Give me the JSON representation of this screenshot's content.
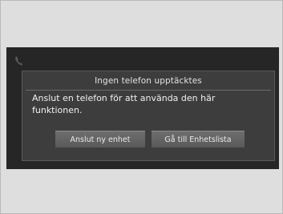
{
  "dialog": {
    "title": "Ingen telefon upptäcktes",
    "message": "Anslut en telefon för att använda den här funktionen.",
    "buttons": {
      "connect_label": "Anslut ny enhet",
      "device_list_label": "Gå till Enhetslista"
    }
  },
  "icons": {
    "status": "phone-handset-icon"
  }
}
